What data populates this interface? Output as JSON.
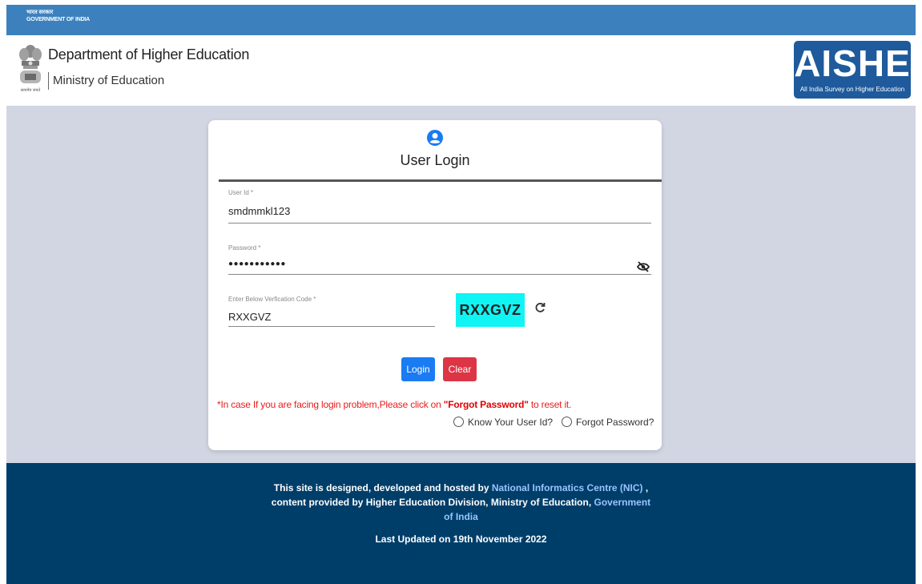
{
  "gov_strip": {
    "hindi": "भारत सरकार",
    "english": "GOVERNMENT OF INDIA"
  },
  "header": {
    "dept_title": "Department of Higher Education",
    "ministry": "Ministry of Education",
    "emblem_caption": "सत्यमेव जयते",
    "logo": {
      "text": "AISHE",
      "subtitle": "All India Survey on Higher Education"
    }
  },
  "login": {
    "title": "User Login",
    "user_id": {
      "label": "User Id *",
      "value": "smdmmkl123"
    },
    "password": {
      "label": "Password *",
      "value": "●●●●●●●●●●●"
    },
    "captcha_field": {
      "label": "Enter Below Verfication Code *",
      "value": "RXXGVZ"
    },
    "captcha_image_text": "RXXGVZ",
    "buttons": {
      "login": "Login",
      "clear": "Clear"
    },
    "help": {
      "prefix": "*In case If you are facing login problem,Please click on ",
      "link": "\"Forgot Password\"",
      "suffix": " to reset it."
    },
    "options": {
      "know_user_id": "Know Your User Id?",
      "forgot_password": "Forgot Password?"
    }
  },
  "footer": {
    "line1_prefix": "This site is designed, developed and hosted by ",
    "line1_link": "National Informatics Centre (NIC)",
    "line1_suffix": " ,",
    "line2_prefix": "content provided by Higher Education Division, Ministry of Education, ",
    "line2_link_a": "Government",
    "line3_link_b": "of India",
    "last_updated": "Last Updated on 19th November 2022"
  },
  "colors": {
    "gov_strip": "#3c81bd",
    "main_bg": "#d2d6e3",
    "footer_bg": "#003e6a",
    "login_button": "#1a7bf2",
    "clear_button": "#dc3545",
    "captcha_bg": "#10f4f4",
    "footer_link": "#98c3ff"
  },
  "icons": [
    "user-circle-icon",
    "eye-slash-icon",
    "refresh-icon",
    "national-emblem-icon"
  ]
}
